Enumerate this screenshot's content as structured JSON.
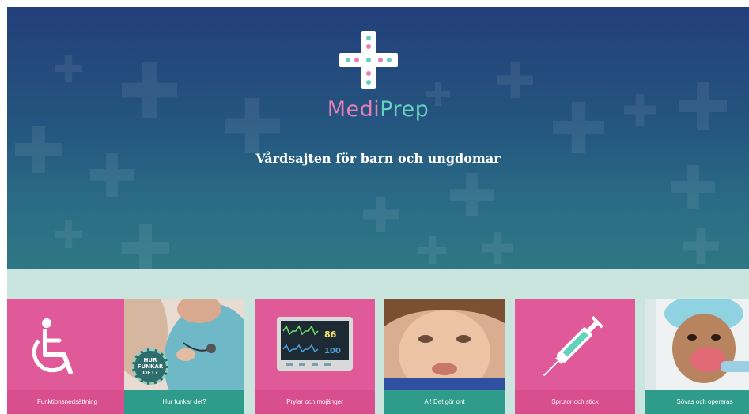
{
  "hero": {
    "brand_medi": "Medi",
    "brand_prep": "Prep",
    "tagline": "Vårdsajten för barn och ungdomar"
  },
  "cards": [
    {
      "label": "Funktionsnedsättning",
      "icon": "wheelchair-icon"
    },
    {
      "label": "Hur funkar det?",
      "icon": "stethoscope-photo",
      "badge": "HUR FUNKAR DET?"
    },
    {
      "label": "Prylar och mojänger",
      "icon": "vital-monitor-icon",
      "monitor_top": "86",
      "monitor_bottom": "100"
    },
    {
      "label": "Aj! Det gör ont",
      "icon": "crying-boy-photo"
    },
    {
      "label": "Sprutor och stick",
      "icon": "syringe-icon"
    },
    {
      "label": "Sövas och opereras",
      "icon": "anesthesia-mask-photo"
    }
  ],
  "colors": {
    "hero_top": "#233f7a",
    "hero_bottom": "#2f7784",
    "band": "#c9e5dd",
    "pink": "#e05a99",
    "teal": "#2f9b8a",
    "brand_pink": "#e87eb9",
    "brand_teal": "#66d0bf"
  }
}
